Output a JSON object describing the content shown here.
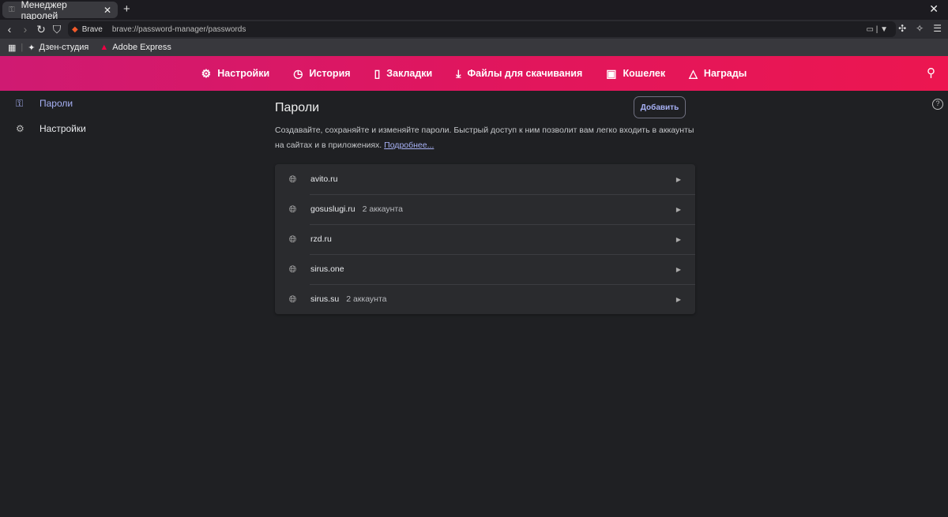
{
  "browser": {
    "tab_title": "Менеджер паролей",
    "brave_label": "Brave",
    "url": "brave://password-manager/passwords",
    "bookmarks": [
      {
        "label": "Дзен-студия"
      },
      {
        "label": "Adobe Express"
      }
    ]
  },
  "header": {
    "items": [
      {
        "label": "Настройки",
        "icon": "gear-icon"
      },
      {
        "label": "История",
        "icon": "history-icon"
      },
      {
        "label": "Закладки",
        "icon": "bookmark-icon"
      },
      {
        "label": "Файлы для скачивания",
        "icon": "download-icon"
      },
      {
        "label": "Кошелек",
        "icon": "wallet-icon"
      },
      {
        "label": "Награды",
        "icon": "rewards-icon"
      }
    ]
  },
  "sidebar": {
    "items": [
      {
        "label": "Пароли"
      },
      {
        "label": "Настройки"
      }
    ]
  },
  "main": {
    "title": "Пароли",
    "add_label": "Добавить",
    "description": "Создавайте, сохраняйте и изменяйте пароли. Быстрый доступ к ним позволит вам легко входить в аккаунты на сайтах и в приложениях.",
    "learn_more": "Подробнее...",
    "sites": [
      {
        "domain": "avito.ru",
        "count": ""
      },
      {
        "domain": "gosuslugi.ru",
        "count": "2 аккаунта"
      },
      {
        "domain": "rzd.ru",
        "count": ""
      },
      {
        "domain": "sirus.one",
        "count": ""
      },
      {
        "domain": "sirus.su",
        "count": "2 аккаунта"
      }
    ]
  },
  "colors": {
    "accent": "#a7b1f5",
    "header_start": "#cf1a72",
    "header_end": "#ec1650"
  }
}
